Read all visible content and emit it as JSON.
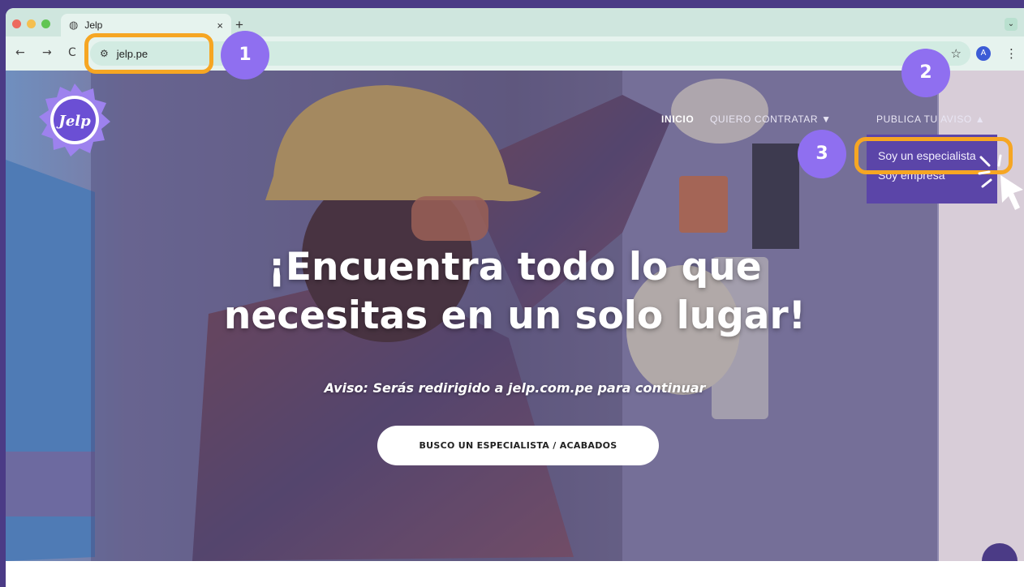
{
  "browser": {
    "tab_title": "Jelp",
    "close_glyph": "×",
    "new_tab_glyph": "+",
    "url": "jelp.pe",
    "back_glyph": "←",
    "forward_glyph": "→",
    "reload_glyph": "C",
    "star_glyph": "☆",
    "avatar_letter": "A",
    "menu_glyph": "⋮",
    "tab_search_glyph": "⌄"
  },
  "site": {
    "logo_text": "Jelp",
    "nav": {
      "inicio": "INICIO",
      "quiero_contratar": "QUIERO CONTRATAR ▼",
      "publica_tu_aviso": "PUBLICA TU AVISO ▲"
    },
    "dropdown": {
      "items": [
        "Soy un especialista",
        "Soy empresa"
      ]
    },
    "headline_line1": "¡Encuentra todo lo que",
    "headline_line2": "necesitas en un solo lugar!",
    "notice": "Aviso: Serás redirigido a jelp.com.pe para continuar",
    "cta_label": "BUSCO UN ESPECIALISTA / ACABADOS"
  },
  "annotations": {
    "step1": "1",
    "step2": "2",
    "step3": "3"
  },
  "colors": {
    "background": "#4b3b86",
    "highlight": "#f6a623",
    "badge": "#8f6ff0",
    "dropdown": "#5b45a8",
    "browser_chrome": "#cfe6de"
  }
}
